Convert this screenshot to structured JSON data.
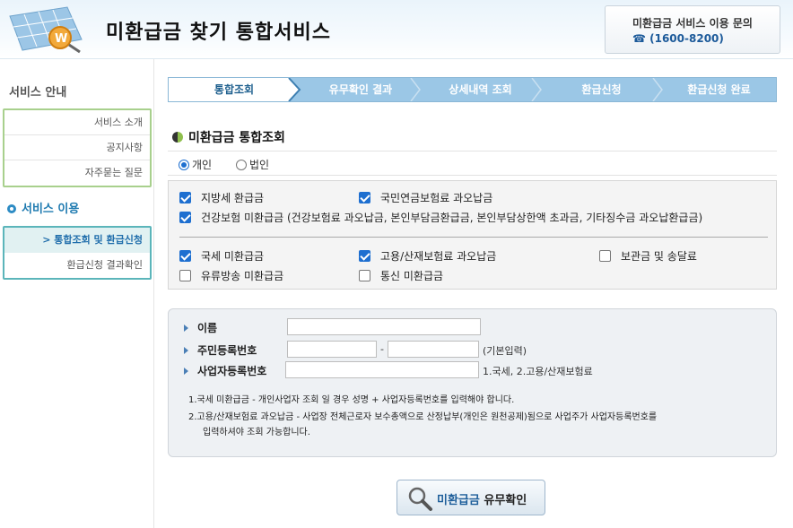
{
  "header": {
    "title": "미환급금 찾기 통합서비스",
    "contact_title": "미환급금 서비스 이용 문의",
    "contact_phone": "☎ (1600-8200)"
  },
  "sidebar": {
    "section1_title": "서비스 안내",
    "section1_items": [
      "서비스 소개",
      "공지사항",
      "자주묻는 질문"
    ],
    "section2_title": "서비스 이용",
    "section2_items": [
      "> 통합조회 및 환급신청",
      "환급신청 결과확인"
    ]
  },
  "steps": [
    "통합조회",
    "유무확인 결과",
    "상세내역 조회",
    "환급신청",
    "환급신청 완료"
  ],
  "main": {
    "section_title": "미환급금 통합조회",
    "radio_individual": "개인",
    "radio_corporate": "법인",
    "checks": {
      "c1": "지방세 환급금",
      "c2": "국민연금보험료 과오납금",
      "c3": "건강보험 미환급금 (건강보험료 과오납금, 본인부담금환급금, 본인부담상한액 초과금, 기타징수금 과오납환급금)",
      "c4": "국세 미환급금",
      "c5": "고용/산재보험료 과오납금",
      "c6": "보관금 및 송달료",
      "c7": "유류방송 미환급금",
      "c8": "통신 미환급금"
    },
    "checked": {
      "c1": true,
      "c2": true,
      "c3": true,
      "c4": true,
      "c5": true,
      "c6": false,
      "c7": false,
      "c8": false
    },
    "form": {
      "name_label": "이름",
      "rrn_label": "주민등록번호",
      "rrn_dash": "-",
      "rrn_hint": "(기본입력)",
      "biz_label": "사업자등록번호",
      "biz_hint": "1.국세, 2.고용/산재보험료",
      "note1": "1.국세 미환급금 - 개인사업자 조회 일 경우 성명 + 사업자등록번호를 입력해야 합니다.",
      "note2": "2.고용/산재보험료 과오납금 - 사업장 전체근로자 보수총액으로 산정납부(개인은 원천공제)됨으로 사업주가 사업자등록번호를",
      "note3": "입력하셔야 조회 가능합니다."
    },
    "button_part1": "미환급금",
    "button_part2": " 유무확인"
  }
}
